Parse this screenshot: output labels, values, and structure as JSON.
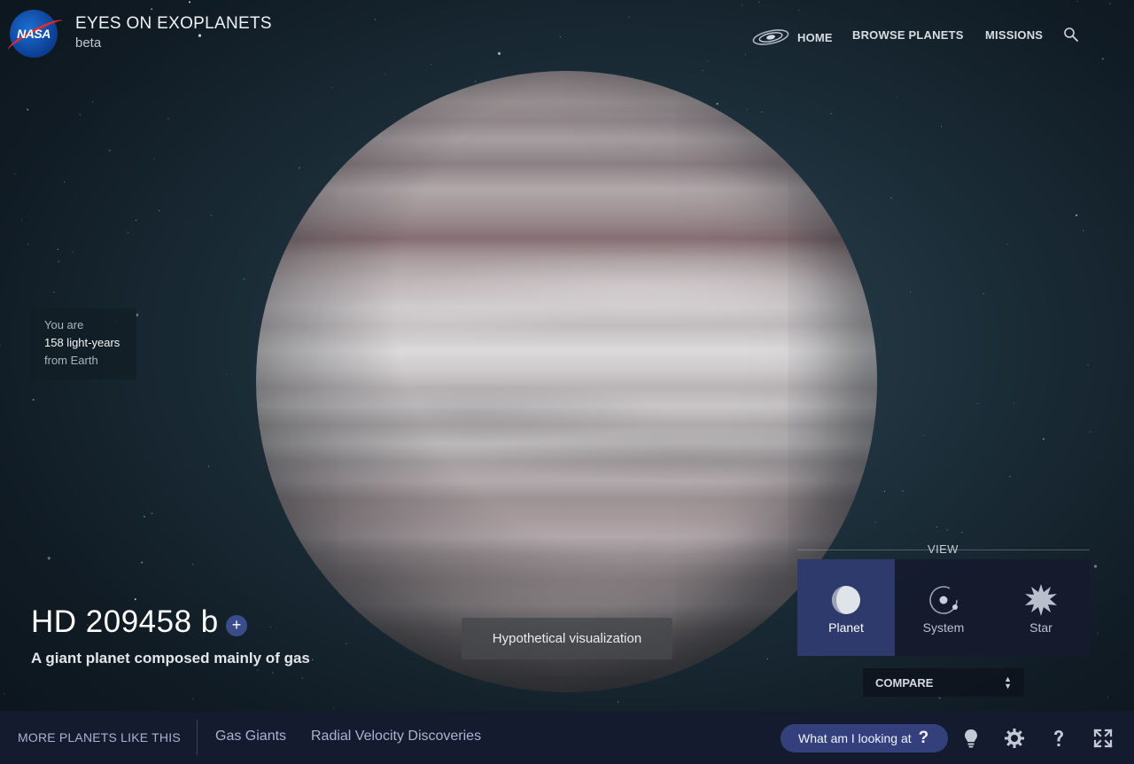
{
  "header": {
    "logo": "NASA",
    "app_title": "EYES ON EXOPLANETS",
    "app_subtitle": "beta",
    "nav": {
      "home": "HOME",
      "browse": "BROWSE PLANETS",
      "missions": "MISSIONS"
    },
    "icons": [
      "galaxy-icon",
      "search-icon"
    ]
  },
  "distance": {
    "line1": "You are",
    "line2": "158 light-years",
    "line3": "from Earth"
  },
  "planet": {
    "name": "HD 209458 b",
    "add_symbol": "+",
    "description": "A giant planet composed mainly of gas"
  },
  "visualization_note": "Hypothetical visualization",
  "view": {
    "label": "VIEW",
    "options": [
      {
        "label": "Planet",
        "icon": "planet-icon",
        "active": true
      },
      {
        "label": "System",
        "icon": "system-icon",
        "active": false
      },
      {
        "label": "Star",
        "icon": "star-icon",
        "active": false
      }
    ]
  },
  "compare": {
    "label": "COMPARE"
  },
  "footer": {
    "more_label": "MORE PLANETS LIKE THIS",
    "links": [
      "Gas Giants",
      "Radial Velocity Discoveries"
    ],
    "what_button": "What am I looking at",
    "what_symbol": "?",
    "icons": [
      "lightbulb-icon",
      "settings-icon",
      "help-icon",
      "fullscreen-icon"
    ]
  },
  "colors": {
    "background": "#1c2e39",
    "footer": "#151b2e",
    "accent": "#34407c",
    "view_active": "#2e3a6b"
  }
}
